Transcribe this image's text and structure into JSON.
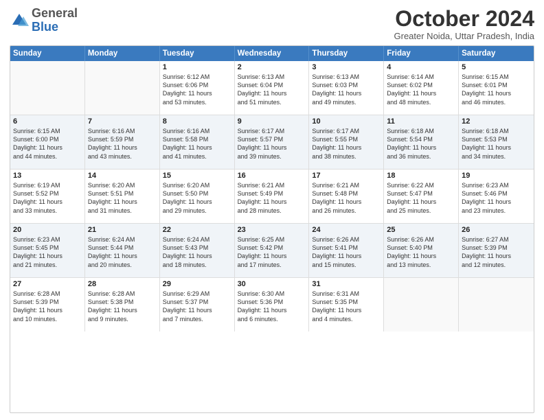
{
  "logo": {
    "general": "General",
    "blue": "Blue"
  },
  "header": {
    "month": "October 2024",
    "location": "Greater Noida, Uttar Pradesh, India"
  },
  "weekdays": [
    "Sunday",
    "Monday",
    "Tuesday",
    "Wednesday",
    "Thursday",
    "Friday",
    "Saturday"
  ],
  "weeks": [
    [
      {
        "day": "",
        "lines": [],
        "empty": true
      },
      {
        "day": "",
        "lines": [],
        "empty": true
      },
      {
        "day": "1",
        "lines": [
          "Sunrise: 6:12 AM",
          "Sunset: 6:06 PM",
          "Daylight: 11 hours",
          "and 53 minutes."
        ],
        "empty": false
      },
      {
        "day": "2",
        "lines": [
          "Sunrise: 6:13 AM",
          "Sunset: 6:04 PM",
          "Daylight: 11 hours",
          "and 51 minutes."
        ],
        "empty": false
      },
      {
        "day": "3",
        "lines": [
          "Sunrise: 6:13 AM",
          "Sunset: 6:03 PM",
          "Daylight: 11 hours",
          "and 49 minutes."
        ],
        "empty": false
      },
      {
        "day": "4",
        "lines": [
          "Sunrise: 6:14 AM",
          "Sunset: 6:02 PM",
          "Daylight: 11 hours",
          "and 48 minutes."
        ],
        "empty": false
      },
      {
        "day": "5",
        "lines": [
          "Sunrise: 6:15 AM",
          "Sunset: 6:01 PM",
          "Daylight: 11 hours",
          "and 46 minutes."
        ],
        "empty": false
      }
    ],
    [
      {
        "day": "6",
        "lines": [
          "Sunrise: 6:15 AM",
          "Sunset: 6:00 PM",
          "Daylight: 11 hours",
          "and 44 minutes."
        ],
        "empty": false
      },
      {
        "day": "7",
        "lines": [
          "Sunrise: 6:16 AM",
          "Sunset: 5:59 PM",
          "Daylight: 11 hours",
          "and 43 minutes."
        ],
        "empty": false
      },
      {
        "day": "8",
        "lines": [
          "Sunrise: 6:16 AM",
          "Sunset: 5:58 PM",
          "Daylight: 11 hours",
          "and 41 minutes."
        ],
        "empty": false
      },
      {
        "day": "9",
        "lines": [
          "Sunrise: 6:17 AM",
          "Sunset: 5:57 PM",
          "Daylight: 11 hours",
          "and 39 minutes."
        ],
        "empty": false
      },
      {
        "day": "10",
        "lines": [
          "Sunrise: 6:17 AM",
          "Sunset: 5:55 PM",
          "Daylight: 11 hours",
          "and 38 minutes."
        ],
        "empty": false
      },
      {
        "day": "11",
        "lines": [
          "Sunrise: 6:18 AM",
          "Sunset: 5:54 PM",
          "Daylight: 11 hours",
          "and 36 minutes."
        ],
        "empty": false
      },
      {
        "day": "12",
        "lines": [
          "Sunrise: 6:18 AM",
          "Sunset: 5:53 PM",
          "Daylight: 11 hours",
          "and 34 minutes."
        ],
        "empty": false
      }
    ],
    [
      {
        "day": "13",
        "lines": [
          "Sunrise: 6:19 AM",
          "Sunset: 5:52 PM",
          "Daylight: 11 hours",
          "and 33 minutes."
        ],
        "empty": false
      },
      {
        "day": "14",
        "lines": [
          "Sunrise: 6:20 AM",
          "Sunset: 5:51 PM",
          "Daylight: 11 hours",
          "and 31 minutes."
        ],
        "empty": false
      },
      {
        "day": "15",
        "lines": [
          "Sunrise: 6:20 AM",
          "Sunset: 5:50 PM",
          "Daylight: 11 hours",
          "and 29 minutes."
        ],
        "empty": false
      },
      {
        "day": "16",
        "lines": [
          "Sunrise: 6:21 AM",
          "Sunset: 5:49 PM",
          "Daylight: 11 hours",
          "and 28 minutes."
        ],
        "empty": false
      },
      {
        "day": "17",
        "lines": [
          "Sunrise: 6:21 AM",
          "Sunset: 5:48 PM",
          "Daylight: 11 hours",
          "and 26 minutes."
        ],
        "empty": false
      },
      {
        "day": "18",
        "lines": [
          "Sunrise: 6:22 AM",
          "Sunset: 5:47 PM",
          "Daylight: 11 hours",
          "and 25 minutes."
        ],
        "empty": false
      },
      {
        "day": "19",
        "lines": [
          "Sunrise: 6:23 AM",
          "Sunset: 5:46 PM",
          "Daylight: 11 hours",
          "and 23 minutes."
        ],
        "empty": false
      }
    ],
    [
      {
        "day": "20",
        "lines": [
          "Sunrise: 6:23 AM",
          "Sunset: 5:45 PM",
          "Daylight: 11 hours",
          "and 21 minutes."
        ],
        "empty": false
      },
      {
        "day": "21",
        "lines": [
          "Sunrise: 6:24 AM",
          "Sunset: 5:44 PM",
          "Daylight: 11 hours",
          "and 20 minutes."
        ],
        "empty": false
      },
      {
        "day": "22",
        "lines": [
          "Sunrise: 6:24 AM",
          "Sunset: 5:43 PM",
          "Daylight: 11 hours",
          "and 18 minutes."
        ],
        "empty": false
      },
      {
        "day": "23",
        "lines": [
          "Sunrise: 6:25 AM",
          "Sunset: 5:42 PM",
          "Daylight: 11 hours",
          "and 17 minutes."
        ],
        "empty": false
      },
      {
        "day": "24",
        "lines": [
          "Sunrise: 6:26 AM",
          "Sunset: 5:41 PM",
          "Daylight: 11 hours",
          "and 15 minutes."
        ],
        "empty": false
      },
      {
        "day": "25",
        "lines": [
          "Sunrise: 6:26 AM",
          "Sunset: 5:40 PM",
          "Daylight: 11 hours",
          "and 13 minutes."
        ],
        "empty": false
      },
      {
        "day": "26",
        "lines": [
          "Sunrise: 6:27 AM",
          "Sunset: 5:39 PM",
          "Daylight: 11 hours",
          "and 12 minutes."
        ],
        "empty": false
      }
    ],
    [
      {
        "day": "27",
        "lines": [
          "Sunrise: 6:28 AM",
          "Sunset: 5:39 PM",
          "Daylight: 11 hours",
          "and 10 minutes."
        ],
        "empty": false
      },
      {
        "day": "28",
        "lines": [
          "Sunrise: 6:28 AM",
          "Sunset: 5:38 PM",
          "Daylight: 11 hours",
          "and 9 minutes."
        ],
        "empty": false
      },
      {
        "day": "29",
        "lines": [
          "Sunrise: 6:29 AM",
          "Sunset: 5:37 PM",
          "Daylight: 11 hours",
          "and 7 minutes."
        ],
        "empty": false
      },
      {
        "day": "30",
        "lines": [
          "Sunrise: 6:30 AM",
          "Sunset: 5:36 PM",
          "Daylight: 11 hours",
          "and 6 minutes."
        ],
        "empty": false
      },
      {
        "day": "31",
        "lines": [
          "Sunrise: 6:31 AM",
          "Sunset: 5:35 PM",
          "Daylight: 11 hours",
          "and 4 minutes."
        ],
        "empty": false
      },
      {
        "day": "",
        "lines": [],
        "empty": true
      },
      {
        "day": "",
        "lines": [],
        "empty": true
      }
    ]
  ]
}
